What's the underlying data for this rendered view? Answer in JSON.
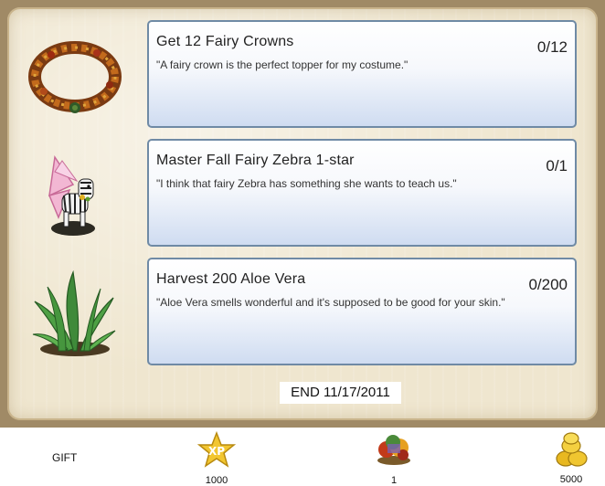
{
  "quests": [
    {
      "title": "Get 12 Fairy Crowns",
      "description": "\"A fairy crown is the perfect topper for my costume.\"",
      "progress": "0/12",
      "icon": "fairy-crown-icon"
    },
    {
      "title": "Master Fall Fairy Zebra 1-star",
      "description": "\"I think that fairy Zebra has something she wants to teach us.\"",
      "progress": "0/1",
      "icon": "fairy-zebra-icon"
    },
    {
      "title": "Harvest 200 Aloe Vera",
      "description": "\"Aloe Vera smells wonderful and it's supposed to be good for your skin.\"",
      "progress": "0/200",
      "icon": "aloe-vera-icon"
    }
  ],
  "end_label": "END 11/17/2011",
  "rewards": {
    "gift_label": "GIFT",
    "xp": {
      "icon": "xp-star-icon",
      "amount": "1000"
    },
    "item": {
      "icon": "gift-item-icon",
      "amount": "1"
    },
    "coins": {
      "icon": "coins-icon",
      "amount": "5000"
    }
  }
}
